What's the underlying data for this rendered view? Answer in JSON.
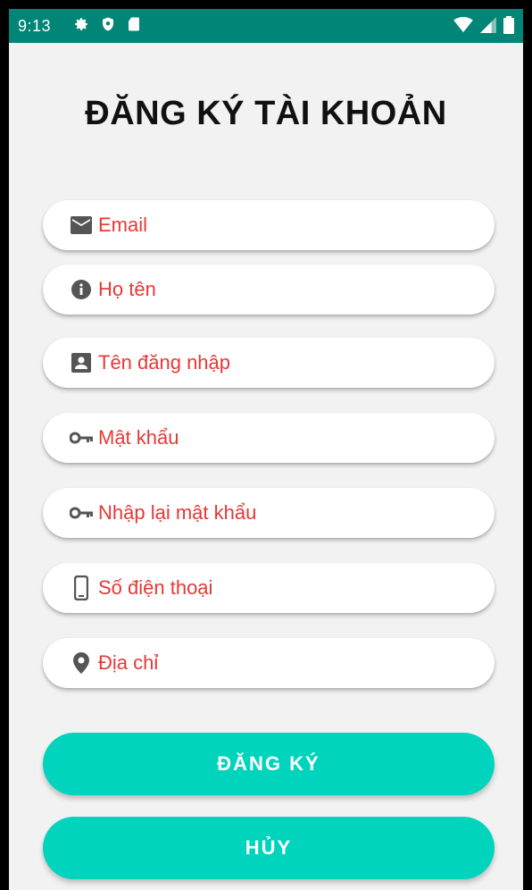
{
  "status_bar": {
    "time": "9:13",
    "left_icons": [
      "settings-icon",
      "shield-icon",
      "sd-card-icon"
    ],
    "right_icons": [
      "wifi-icon",
      "signal-icon",
      "battery-icon"
    ],
    "color": "#008577"
  },
  "title": "ĐĂNG KÝ TÀI KHOẢN",
  "fields": [
    {
      "icon": "email-icon",
      "placeholder": "Email"
    },
    {
      "icon": "info-icon",
      "placeholder": "Họ tên"
    },
    {
      "icon": "account-box-icon",
      "placeholder": "Tên đăng nhập"
    },
    {
      "icon": "key-icon",
      "placeholder": "Mật khẩu"
    },
    {
      "icon": "key-icon",
      "placeholder": "Nhập lại mật khẩu"
    },
    {
      "icon": "phone-icon",
      "placeholder": "Số điện thoại"
    },
    {
      "icon": "location-icon",
      "placeholder": "Địa chỉ"
    }
  ],
  "buttons": {
    "register_label": "ĐĂNG KÝ",
    "cancel_label": "HỦY"
  },
  "colors": {
    "accent": "#00d4bc",
    "placeholder_text": "#e53935",
    "background": "#f2f2f2"
  }
}
